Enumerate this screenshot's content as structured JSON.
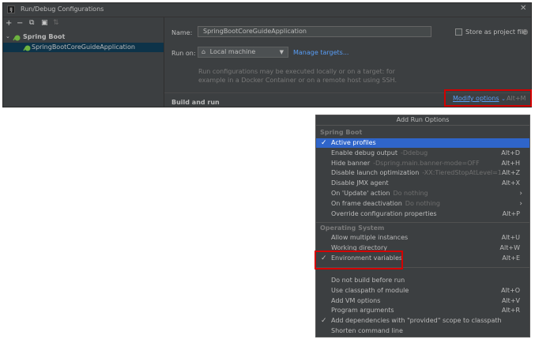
{
  "window": {
    "title": "Run/Debug Configurations",
    "close_glyph": "✕",
    "toolbar": [
      "+",
      "−",
      "⧉",
      "▣",
      "⇅"
    ],
    "tree": {
      "root_label": "Spring Boot",
      "child_label": "SpringBootCoreGuideApplication"
    },
    "form": {
      "name_label": "Name:",
      "name_value": "SpringBootCoreGuideApplication",
      "store_label": "Store as project file",
      "run_on_label": "Run on:",
      "run_on_value": "Local machine",
      "manage_targets": "Manage targets...",
      "help_line1": "Run configurations may be executed locally or on a target: for",
      "help_line2": "example in a Docker Container or on a remote host using SSH.",
      "build_and_run": "Build and run",
      "modify_options": "Modify options",
      "modify_shortcut": "Alt+M"
    }
  },
  "popup": {
    "title": "Add Run Options",
    "sections": {
      "spring_boot": "Spring Boot",
      "operating_system": "Operating System"
    },
    "spring_items": [
      {
        "label": "Active profiles",
        "hint": "",
        "shortcut": "",
        "checked": true
      },
      {
        "label": "Enable debug output",
        "hint": "-Ddebug",
        "shortcut": "Alt+D",
        "checked": false
      },
      {
        "label": "Hide banner",
        "hint": "-Dspring.main.banner-mode=OFF",
        "shortcut": "Alt+H",
        "checked": false
      },
      {
        "label": "Disable launch optimization",
        "hint": "-XX:TieredStopAtLevel=1",
        "shortcut": "Alt+Z",
        "checked": false
      },
      {
        "label": "Disable JMX agent",
        "hint": "",
        "shortcut": "Alt+X",
        "checked": false
      },
      {
        "label": "On 'Update' action",
        "hint": "Do nothing",
        "shortcut": "",
        "checked": false
      },
      {
        "label": "On frame deactivation",
        "hint": "Do nothing",
        "shortcut": "",
        "checked": false
      },
      {
        "label": "Override configuration properties",
        "hint": "",
        "shortcut": "Alt+P",
        "checked": false
      }
    ],
    "os_items": [
      {
        "label": "Allow multiple instances",
        "shortcut": "Alt+U",
        "checked": false
      },
      {
        "label": "Working directory",
        "shortcut": "Alt+W",
        "checked": false
      },
      {
        "label": "Environment variables",
        "shortcut": "Alt+E",
        "checked": true
      }
    ],
    "java_items": [
      {
        "label": "Do not build before run",
        "shortcut": "",
        "checked": false
      },
      {
        "label": "Use classpath of module",
        "shortcut": "Alt+O",
        "checked": false
      },
      {
        "label": "Add VM options",
        "shortcut": "Alt+V",
        "checked": false
      },
      {
        "label": "Program arguments",
        "shortcut": "Alt+R",
        "checked": false
      },
      {
        "label": "Add dependencies with \"provided\" scope to classpath",
        "shortcut": "",
        "checked": true
      },
      {
        "label": "Shorten command line",
        "shortcut": "",
        "checked": false
      }
    ],
    "check_glyph": "✓",
    "arrow_glyph": "›"
  },
  "colors": {
    "highlight_border": "#d40000",
    "selection": "#2f65ca",
    "link": "#589df6"
  }
}
